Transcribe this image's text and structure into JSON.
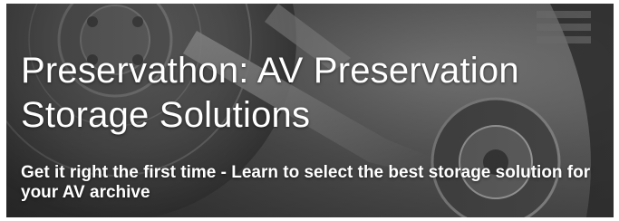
{
  "banner": {
    "title": "Preservathon: AV Preservation Storage Solutions",
    "subtitle": "Get it right the first time - Learn to select the best storage solution for your AV archive",
    "background_image": "hard-drive-platter-photo"
  },
  "colors": {
    "text": "#ffffff",
    "overlay": "#2a2a2a"
  }
}
